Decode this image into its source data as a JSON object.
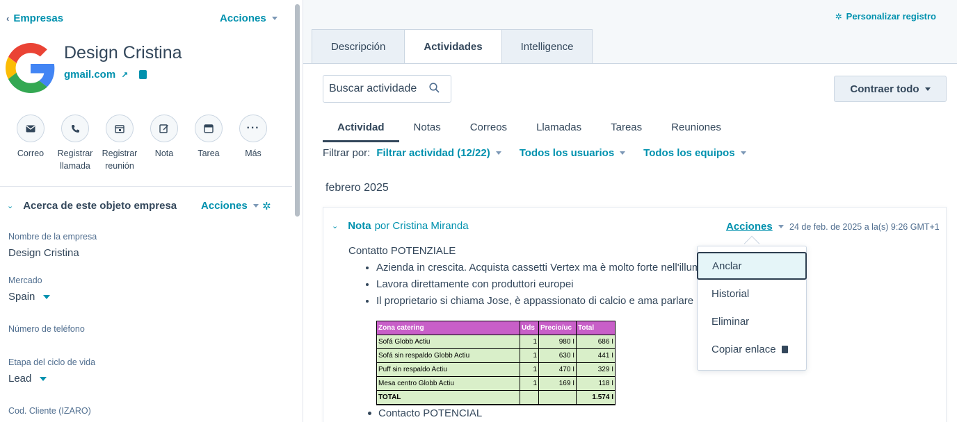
{
  "left_panel": {
    "back_label": "Empresas",
    "acciones_label": "Acciones",
    "company_name": "Design Cristina",
    "domain": "gmail.com",
    "actions": [
      {
        "label": "Correo",
        "icon": "email-icon"
      },
      {
        "label": "Registrar llamada",
        "icon": "phone-icon"
      },
      {
        "label": "Registrar reunión",
        "icon": "calendar-icon"
      },
      {
        "label": "Nota",
        "icon": "edit-icon"
      },
      {
        "label": "Tarea",
        "icon": "task-icon"
      },
      {
        "label": "Más",
        "icon": "more-icon"
      }
    ],
    "about_title": "Acerca de este objeto empresa",
    "about_acciones": "Acciones",
    "properties": [
      {
        "label": "Nombre de la empresa",
        "value": "Design Cristina"
      },
      {
        "label": "Mercado",
        "value": "Spain"
      },
      {
        "label": "Número de teléfono",
        "value": ""
      },
      {
        "label": "Etapa del ciclo de vida",
        "value": "Lead"
      },
      {
        "label": "Cod. Cliente (IZARO)",
        "value": ""
      }
    ]
  },
  "right_panel": {
    "personalizar": "Personalizar registro",
    "tabs": [
      "Descripción",
      "Actividades",
      "Intelligence"
    ],
    "active_tab": "Actividades",
    "search_placeholder": "Buscar actividade",
    "contraer": "Contraer todo",
    "subtabs": [
      "Actividad",
      "Notas",
      "Correos",
      "Llamadas",
      "Tareas",
      "Reuniones"
    ],
    "filter_label": "Filtrar por:",
    "filters": [
      "Filtrar actividad (12/22)",
      "Todos los usuarios",
      "Todos los equipos"
    ],
    "month": "febrero 2025",
    "note": {
      "type": "Nota",
      "by": "por Cristina Miranda",
      "acciones": "Acciones",
      "timestamp": "24 de feb. de 2025 a la(s) 9:26 GMT+1",
      "heading": "Contatto POTENZIALE",
      "bullets": [
        "Azienda in crescita. Acquista cassetti Vertex ma è molto forte nell'illum",
        "Lavora direttamente con produttori europei",
        "Il proprietario si chiama Jose, è appassionato di calcio e ama parlare"
      ],
      "table": {
        "headers": [
          "Zona catering",
          "Uds",
          "Precio/uc",
          "Total"
        ],
        "rows": [
          [
            "Sofá Globb Actiu",
            "1",
            "980 I",
            "686 I"
          ],
          [
            "Sofá sin respaldo Globb Actiu",
            "1",
            "630 I",
            "441 I"
          ],
          [
            "Puff sin respaldo Actiu",
            "1",
            "470 I",
            "329 I"
          ],
          [
            "Mesa centro Globb Actiu",
            "1",
            "169 I",
            "118 I"
          ]
        ],
        "total": [
          "TOTAL",
          "",
          "",
          "1.574 I"
        ]
      },
      "last_bullet": "Contacto POTENCIAL"
    },
    "menu": [
      "Anclar",
      "Historial",
      "Eliminar",
      "Copiar enlace"
    ]
  },
  "colors": {
    "accent": "#0091ae",
    "text": "#33475b",
    "table_header": "#c85fc8",
    "table_row": "#d9efc9"
  }
}
